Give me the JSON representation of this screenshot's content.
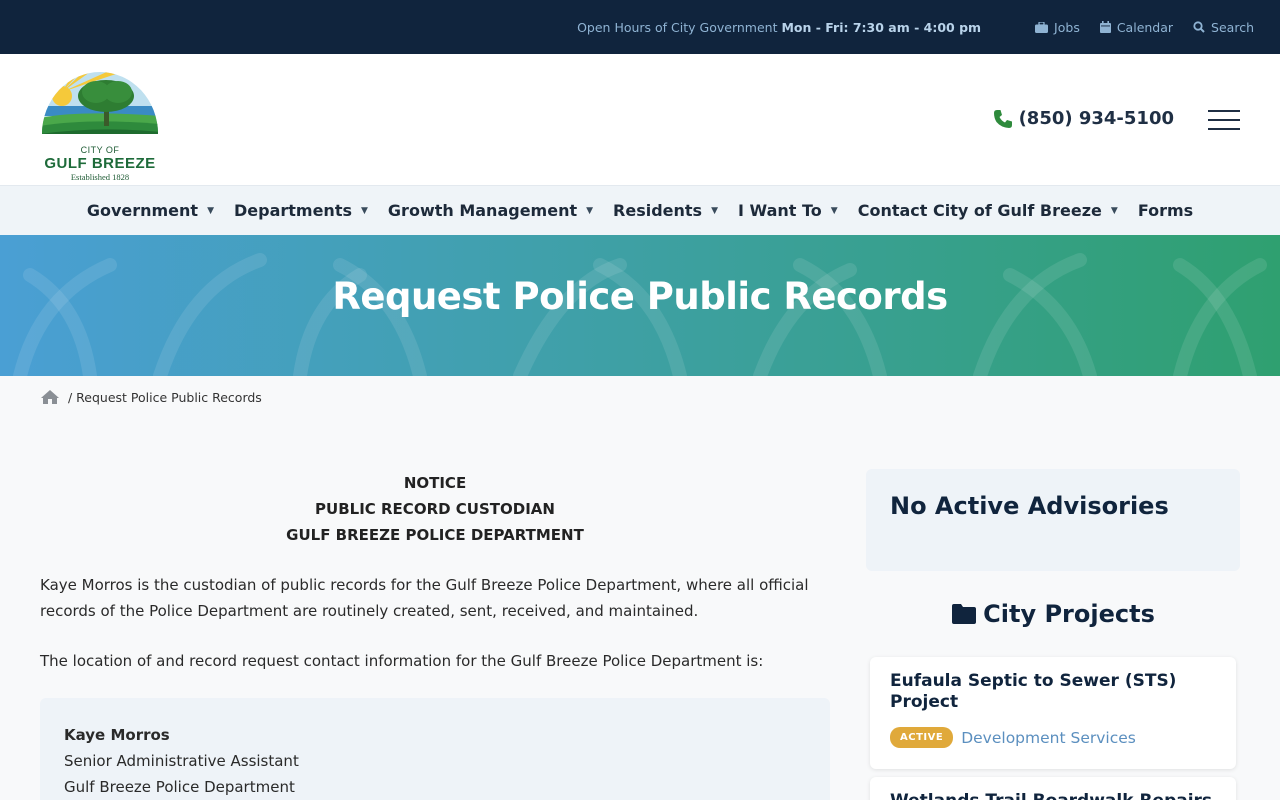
{
  "topbar": {
    "hours_label": "Open Hours of City Government",
    "hours_value": "Mon - Fri: 7:30 am - 4:00 pm",
    "links": [
      {
        "label": "Jobs",
        "icon": "briefcase-icon"
      },
      {
        "label": "Calendar",
        "icon": "calendar-icon"
      },
      {
        "label": "Search",
        "icon": "search-icon"
      }
    ]
  },
  "header": {
    "logo": {
      "city_of": "CITY OF",
      "name": "GULF BREEZE",
      "established": "Established 1828"
    },
    "phone": "(850) 934-5100"
  },
  "nav": {
    "items": [
      {
        "label": "Government",
        "has_dropdown": true
      },
      {
        "label": "Departments",
        "has_dropdown": true
      },
      {
        "label": "Growth Management",
        "has_dropdown": true
      },
      {
        "label": "Residents",
        "has_dropdown": true
      },
      {
        "label": "I Want To",
        "has_dropdown": true
      },
      {
        "label": "Contact City of Gulf Breeze",
        "has_dropdown": true
      },
      {
        "label": "Forms",
        "has_dropdown": false
      }
    ]
  },
  "hero": {
    "title": "Request Police Public Records"
  },
  "breadcrumb": {
    "current": "/ Request Police Public Records"
  },
  "main": {
    "notice": [
      "NOTICE",
      "PUBLIC RECORD CUSTODIAN",
      "GULF BREEZE POLICE DEPARTMENT"
    ],
    "para1": "Kaye Morros is the custodian of public records for the Gulf Breeze Police Department, where all official records of the Police Department are routinely created, sent, received, and maintained.",
    "para2": "The location of and record request contact information for the Gulf Breeze Police Department is:",
    "contact": [
      "Kaye Morros",
      "Senior Administrative Assistant",
      "Gulf Breeze Police Department"
    ]
  },
  "sidebar": {
    "advisory": "No Active Advisories",
    "projects_title": "City Projects",
    "projects": [
      {
        "title": "Eufaula Septic to Sewer (STS) Project",
        "status": "ACTIVE",
        "department": "Development Services"
      },
      {
        "title": "Wetlands Trail Boardwalk Repairs",
        "status": "",
        "department": ""
      }
    ]
  },
  "colors": {
    "topbar": "#10243d",
    "accent_green": "#1e6b3a",
    "badge": "#e0a93a",
    "link": "#5b8fbf"
  }
}
